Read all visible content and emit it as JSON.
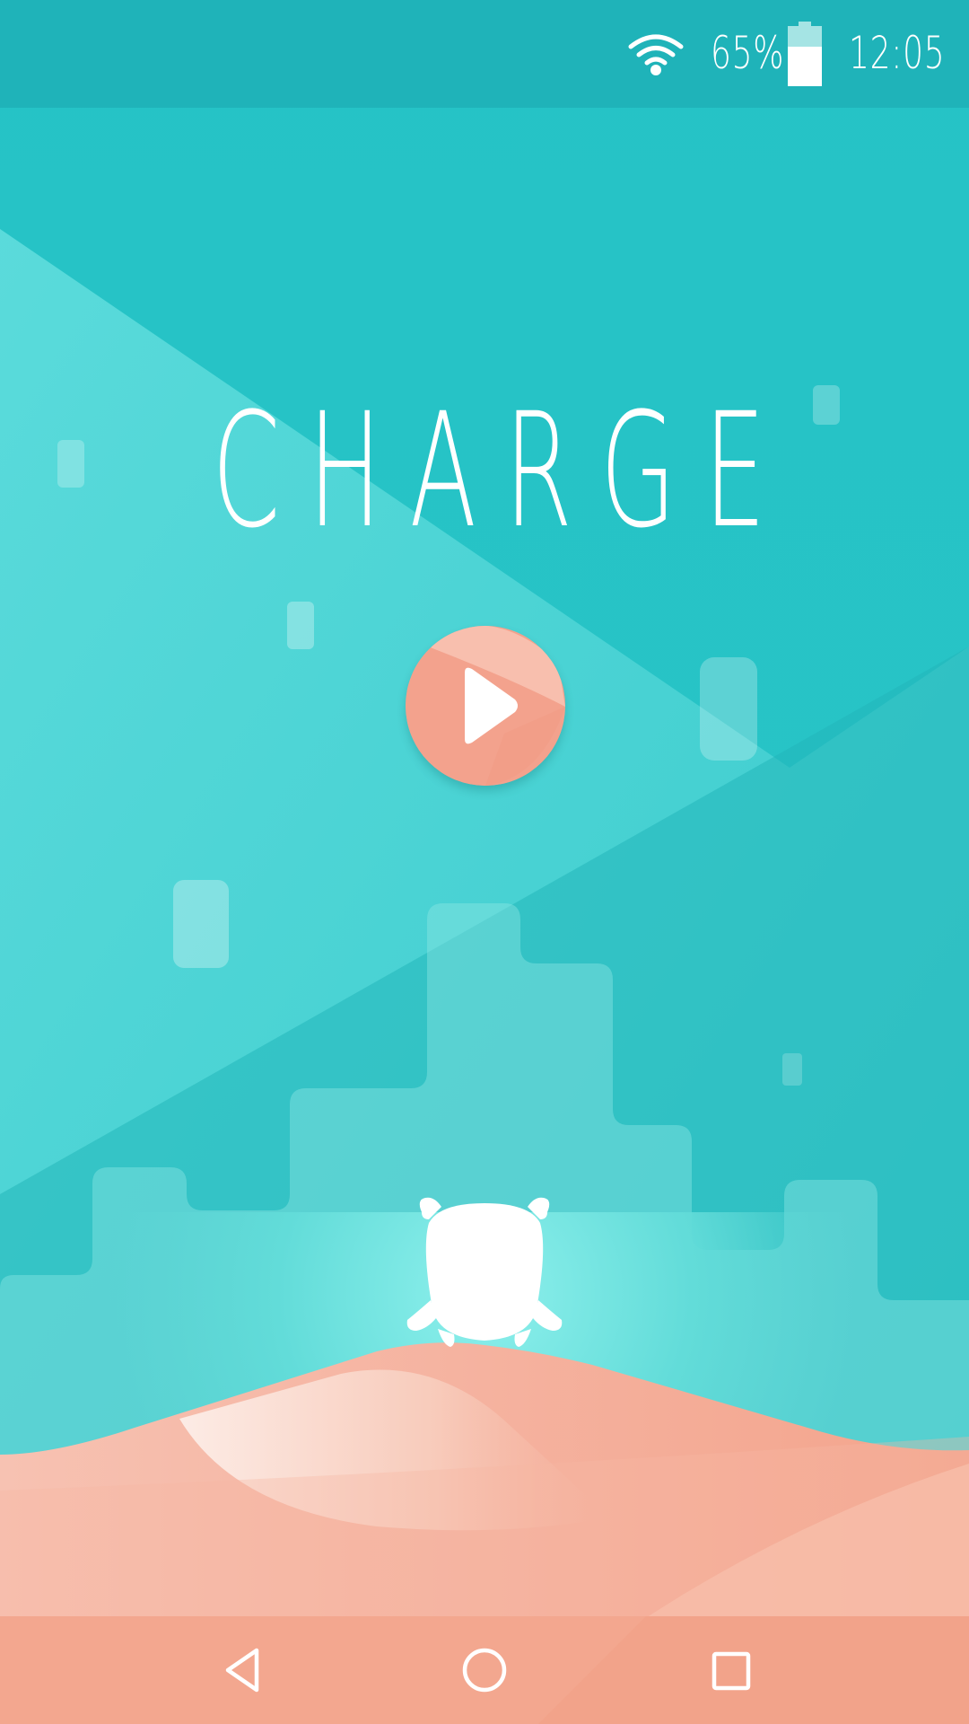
{
  "status_bar": {
    "wifi_icon": "wifi-icon",
    "battery_percent": "65%",
    "battery_icon": "battery-icon",
    "battery_level": 0.65,
    "time": "12:05"
  },
  "game": {
    "title": "CHARGE",
    "play_icon": "play-icon",
    "mascot_icon": "creature-mascot-icon"
  },
  "nav_bar": {
    "back_icon": "back-triangle-icon",
    "home_icon": "home-circle-icon",
    "recent_icon": "recent-apps-square-icon"
  },
  "colors": {
    "status_bar": "#1fb3b9",
    "sky": "#27c3c5",
    "sky_light": "#5fdbdb",
    "sand": "#f4a58f",
    "sand_light": "#fbe0d6",
    "nav_bar": "#f3a58d",
    "play_button": "#f3a490",
    "white": "#ffffff"
  }
}
